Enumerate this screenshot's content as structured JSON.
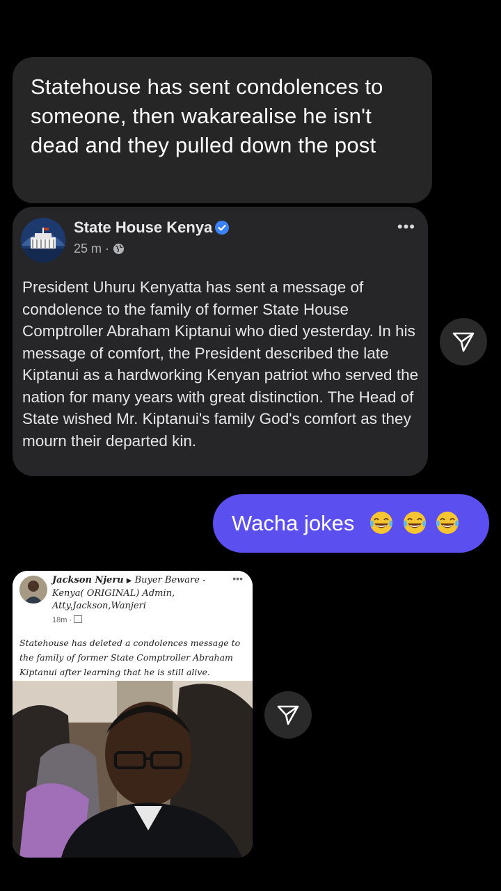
{
  "message_1": {
    "text": "Statehouse has sent condolences to someone, then wakarealise he isn't dead and they pulled down the post"
  },
  "fb_post": {
    "page_name": "State House Kenya",
    "time": "25 m",
    "body": "President Uhuru Kenyatta has sent a message of condolence to the family of former State House Comptroller Abraham Kiptanui who died yesterday. In his message of comfort, the President described the late Kiptanui as a hardworking Kenyan patriot who served the nation for many years with great distinction. The Head of State wished Mr. Kiptanui's family God's comfort as they mourn their departed kin.",
    "menu": "•••"
  },
  "message_2": {
    "text": "Wacha jokes"
  },
  "screenshot_post": {
    "author": "Jackson Njeru",
    "group": "Buyer Beware - Kenya( ORIGINAL) Admin, Atty.Jackson,Wanjeri",
    "time": "18m",
    "body": "Statehouse has deleted a condolences message to the family of former State Comptroller Abraham Kiptanui after learning that he is still alive.",
    "menu": "•••"
  },
  "icons": {
    "share": "paper-plane-icon",
    "verified": "verified-badge-icon",
    "globe": "globe-icon",
    "emoji": "face-with-tears-of-joy"
  },
  "colors": {
    "background": "#000000",
    "bubble_gray": "#262626",
    "bubble_purple": "#5b4ff0"
  }
}
